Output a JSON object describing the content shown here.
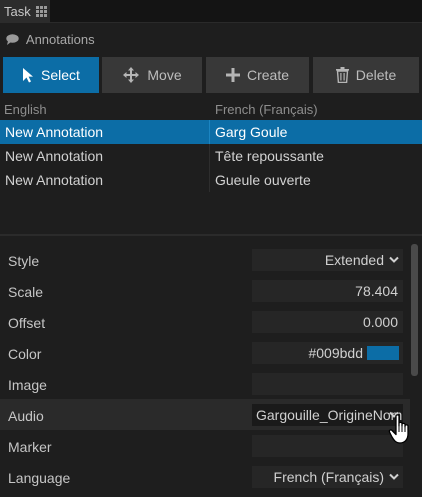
{
  "tab": {
    "label": "Task"
  },
  "panel": {
    "title": "Annotations"
  },
  "toolbar": {
    "select": "Select",
    "move": "Move",
    "create": "Create",
    "delete": "Delete"
  },
  "table": {
    "columns": [
      "English",
      "French (Français)"
    ],
    "rows": [
      {
        "english": "New Annotation",
        "french": "Garg Goule",
        "selected": true
      },
      {
        "english": "New Annotation",
        "french": "Tête repoussante",
        "selected": false
      },
      {
        "english": "New Annotation",
        "french": "Gueule ouverte",
        "selected": false
      }
    ]
  },
  "properties": {
    "style": {
      "label": "Style",
      "value": "Extended"
    },
    "scale": {
      "label": "Scale",
      "value": "78.404"
    },
    "offset": {
      "label": "Offset",
      "value": "0.000"
    },
    "color": {
      "label": "Color",
      "value": "#009bdd"
    },
    "image": {
      "label": "Image",
      "value": ""
    },
    "audio": {
      "label": "Audio",
      "value": "Gargouille_OrigineNom"
    },
    "marker": {
      "label": "Marker",
      "value": ""
    },
    "language": {
      "label": "Language",
      "value": "French (Français)"
    }
  },
  "colors": {
    "accent": "#0c6da6",
    "swatch": "#009bdd",
    "background": "#1e1e1e",
    "button": "#383838"
  }
}
